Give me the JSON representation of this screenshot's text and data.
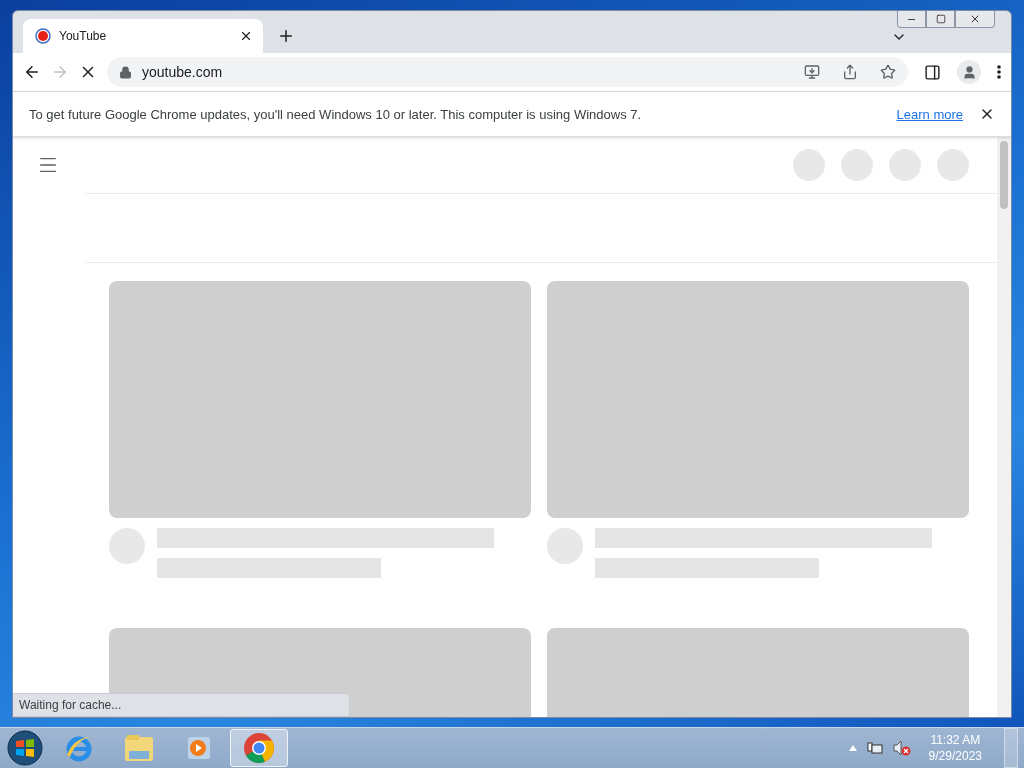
{
  "tabs": [
    {
      "title": "YouTube",
      "selected": true
    }
  ],
  "toolbar": {
    "url": "youtube.com",
    "loading": true
  },
  "infobar": {
    "message": "To get future Google Chrome updates, you'll need Windows 10 or later. This computer is using Windows 7.",
    "link": "Learn more"
  },
  "status_bubble": "Waiting for cache...",
  "taskbar": {
    "apps": [
      {
        "kind": "ie",
        "selected": false
      },
      {
        "kind": "explorer",
        "selected": false
      },
      {
        "kind": "media",
        "selected": false
      },
      {
        "kind": "chrome",
        "selected": true
      }
    ],
    "clock": {
      "time": "11:32 AM",
      "date": "9/29/2023"
    }
  }
}
